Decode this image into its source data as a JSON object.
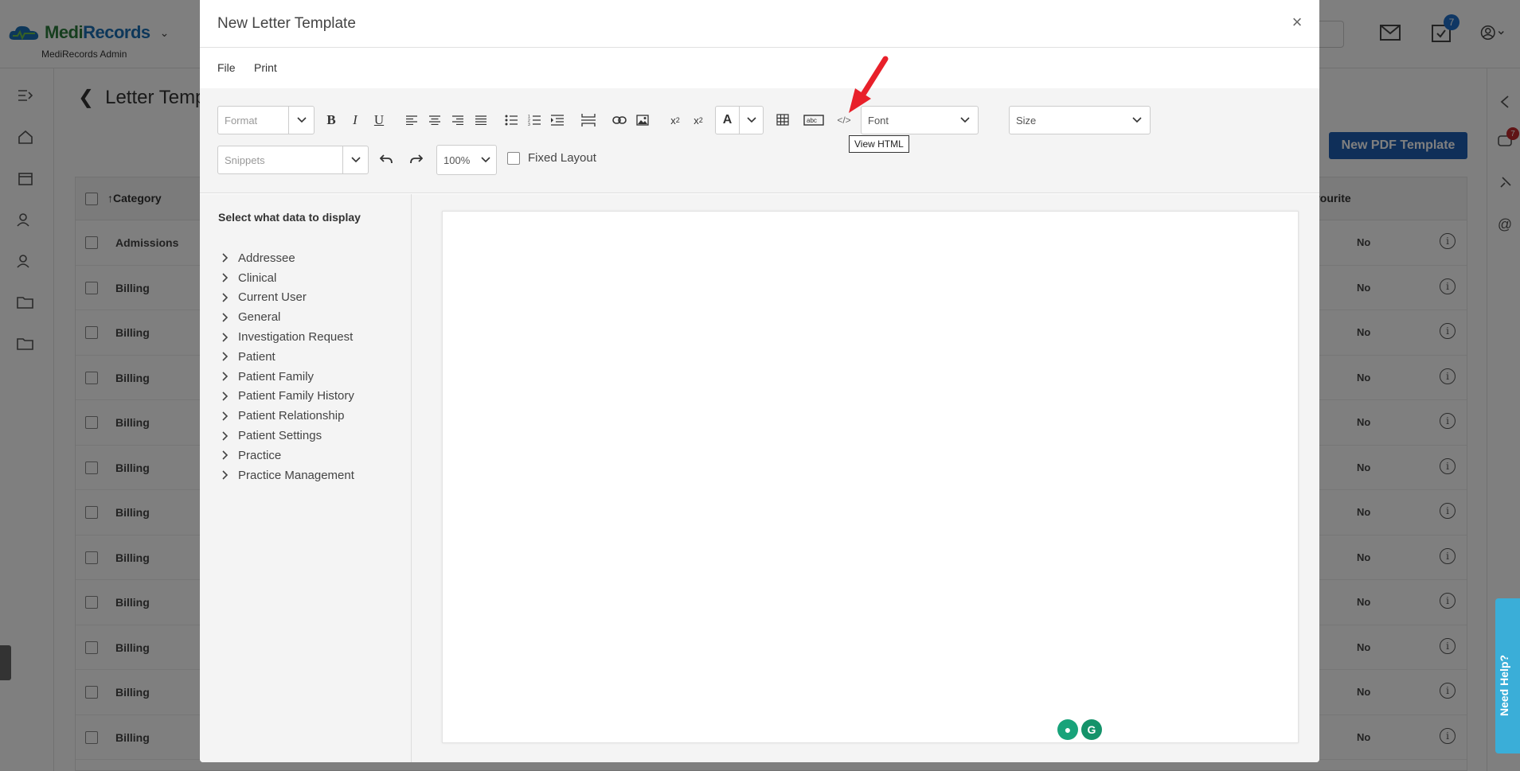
{
  "app": {
    "logo_text_a": "Medi",
    "logo_text_b": "Records",
    "admin_label": "MediRecords Admin",
    "notification_badge": "7",
    "chat_badge": "7"
  },
  "page": {
    "title": "Letter Temp",
    "new_pdf_button": "New PDF Template",
    "table_header_category": "Category",
    "table_header_favourite": "vourite",
    "rows": [
      {
        "category": "Admissions",
        "favourite": "No"
      },
      {
        "category": "Billing",
        "favourite": "No"
      },
      {
        "category": "Billing",
        "favourite": "No"
      },
      {
        "category": "Billing",
        "favourite": "No"
      },
      {
        "category": "Billing",
        "favourite": "No"
      },
      {
        "category": "Billing",
        "favourite": "No"
      },
      {
        "category": "Billing",
        "favourite": "No"
      },
      {
        "category": "Billing",
        "favourite": "No"
      },
      {
        "category": "Billing",
        "favourite": "No"
      },
      {
        "category": "Billing",
        "favourite": "No"
      },
      {
        "category": "Billing",
        "favourite": "No"
      },
      {
        "category": "Billing",
        "favourite": "No"
      }
    ],
    "need_help": "Need Help?"
  },
  "modal": {
    "title": "New Letter Template",
    "menu": [
      "File",
      "Print"
    ],
    "toolbar": {
      "format_placeholder": "Format",
      "snippets_placeholder": "Snippets",
      "zoom_value": "100%",
      "font_placeholder": "Font",
      "size_placeholder": "Size",
      "fixed_layout_label": "Fixed Layout",
      "color_letter": "A",
      "tooltip": "View HTML"
    },
    "sidebar": {
      "title": "Select what data to display",
      "items": [
        "Addressee",
        "Clinical",
        "Current User",
        "General",
        "Investigation Request",
        "Patient",
        "Patient Family",
        "Patient Family History",
        "Patient Relationship",
        "Patient Settings",
        "Practice",
        "Practice Management"
      ]
    }
  },
  "colors": {
    "brand_green": "#2c7d3c",
    "brand_blue": "#1a6fb5",
    "primary_button": "#1e5fb3",
    "annotation_arrow": "#e8202a",
    "need_help_tab": "#3aaed8"
  }
}
